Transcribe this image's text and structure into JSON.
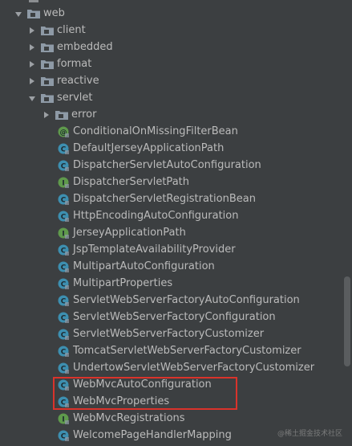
{
  "tree": {
    "root": {
      "label": "web",
      "icon": "package-folder-icon"
    },
    "packages": [
      {
        "label": "client"
      },
      {
        "label": "embedded"
      },
      {
        "label": "format"
      },
      {
        "label": "reactive"
      },
      {
        "label": "servlet"
      }
    ],
    "servlet_children_package": {
      "label": "error"
    },
    "classes": [
      {
        "label": "ConditionalOnMissingFilterBean",
        "kind": "annotation"
      },
      {
        "label": "DefaultJerseyApplicationPath",
        "kind": "class"
      },
      {
        "label": "DispatcherServletAutoConfiguration",
        "kind": "class"
      },
      {
        "label": "DispatcherServletPath",
        "kind": "interface"
      },
      {
        "label": "DispatcherServletRegistrationBean",
        "kind": "class"
      },
      {
        "label": "HttpEncodingAutoConfiguration",
        "kind": "class"
      },
      {
        "label": "JerseyApplicationPath",
        "kind": "interface"
      },
      {
        "label": "JspTemplateAvailabilityProvider",
        "kind": "class"
      },
      {
        "label": "MultipartAutoConfiguration",
        "kind": "class"
      },
      {
        "label": "MultipartProperties",
        "kind": "class"
      },
      {
        "label": "ServletWebServerFactoryAutoConfiguration",
        "kind": "class"
      },
      {
        "label": "ServletWebServerFactoryConfiguration",
        "kind": "class"
      },
      {
        "label": "ServletWebServerFactoryCustomizer",
        "kind": "class"
      },
      {
        "label": "TomcatServletWebServerFactoryCustomizer",
        "kind": "class"
      },
      {
        "label": "UndertowServletWebServerFactoryCustomizer",
        "kind": "class"
      },
      {
        "label": "WebMvcAutoConfiguration",
        "kind": "class"
      },
      {
        "label": "WebMvcProperties",
        "kind": "class"
      },
      {
        "label": "WebMvcRegistrations",
        "kind": "interface"
      },
      {
        "label": "WelcomePageHandlerMapping",
        "kind": "class"
      }
    ]
  },
  "watermark": "@稀土掘金技术社区",
  "colors": {
    "background": "#3c3f41",
    "text": "#bbbbbb",
    "class_icon": "#3d8fb0",
    "interface_icon": "#5f9a4c",
    "annotation_icon": "#5f9a4c",
    "highlight": "#d9332b"
  }
}
